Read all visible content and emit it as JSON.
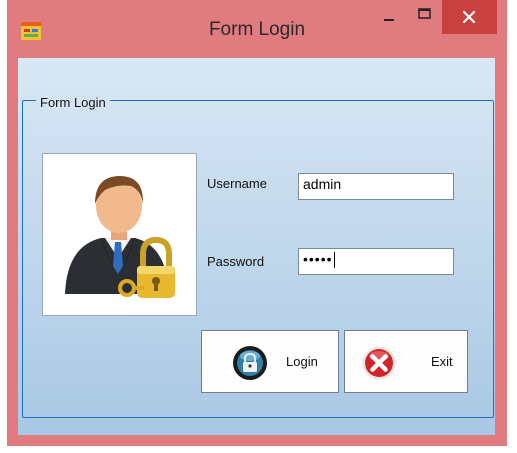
{
  "window": {
    "title": "Form Login",
    "controls": {
      "minimize": "minimize-icon",
      "maximize": "maximize-icon",
      "close": "close-icon"
    }
  },
  "group": {
    "title": "Form Login"
  },
  "fields": {
    "username_label": "Username",
    "username_value": "admin",
    "password_label": "Password",
    "password_value": "•••••"
  },
  "buttons": {
    "login_label": "Login",
    "exit_label": "Exit"
  },
  "colors": {
    "title_bar": "#e07c80",
    "close_button": "#c9413f",
    "group_border": "#1f6ec8"
  }
}
